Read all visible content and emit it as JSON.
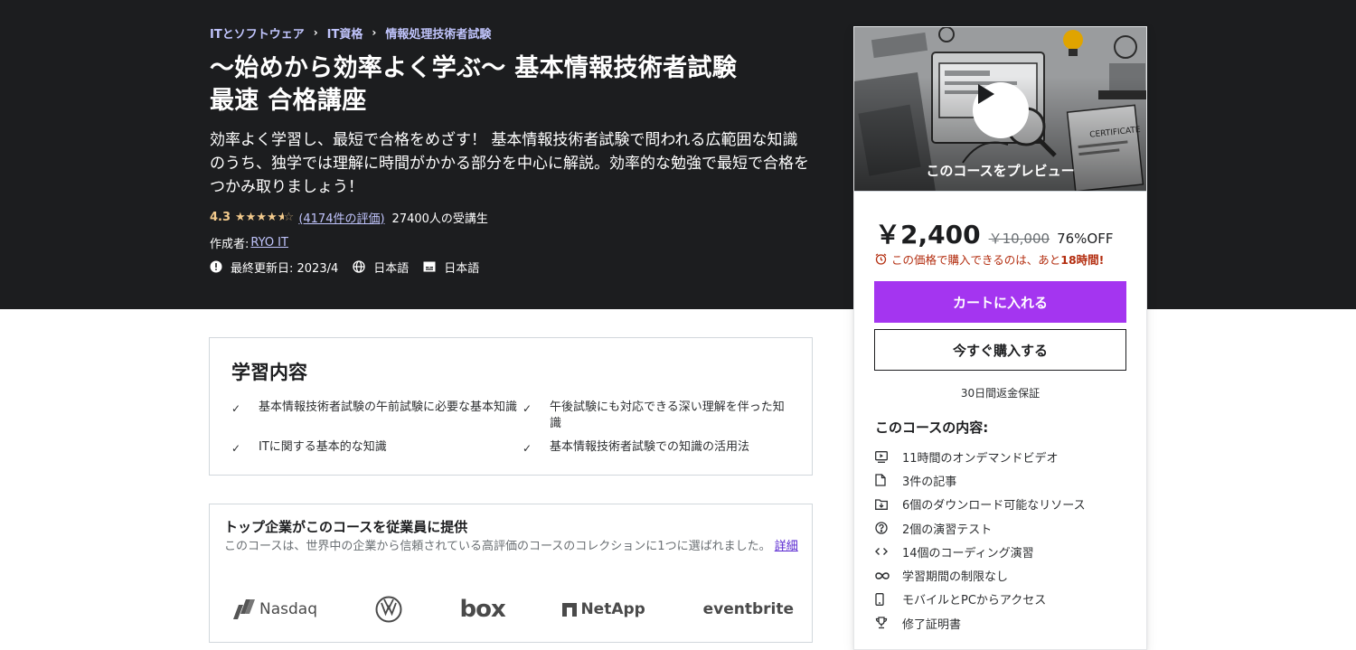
{
  "breadcrumb": [
    "ITとソフトウェア",
    "IT資格",
    "情報処理技術者試験"
  ],
  "course": {
    "title_line1": "〜始めから効率よく学ぶ〜 基本情報技術者試験",
    "title_line2": "最速 合格講座",
    "subtitle": "効率よく学習し、最短で合格をめざす！ 基本情報技術者試験で問われる広範囲な知識のうち、独学では理解に時間がかかる部分を中心に解説。効率的な勉強で最短で合格をつかみ取りましょう！",
    "rating": "4.3",
    "rating_value": 4.3,
    "rating_count": "(4174件の評価)",
    "students": "27400人の受講生",
    "author_label": "作成者:",
    "author": "RYO IT",
    "updated": "最終更新日: 2023/4",
    "language": "日本語",
    "captions": "日本語"
  },
  "learn": {
    "title": "学習内容",
    "items": [
      "基本情報技術者試験の午前試験に必要な基本知識",
      "午後試験にも対応できる深い理解を伴った知識",
      "ITに関する基本的な知識",
      "基本情報技術者試験での知識の活用法"
    ]
  },
  "business": {
    "title": "トップ企業がこのコースを従業員に提供",
    "description": "このコースは、世界中の企業から信頼されている高評価のコースのコレクションに1つに選ばれました。",
    "more": "詳細",
    "logos": [
      "Nasdaq",
      "Volkswagen",
      "box",
      "NetApp",
      "eventbrite"
    ]
  },
  "sidebar": {
    "preview_label": "このコースをプレビュー",
    "price": "￥2,400",
    "original_price": "￥10,000",
    "discount": "76%OFF",
    "urgency_prefix": "この価格で購入できるのは、あと",
    "urgency_time": "18時間!",
    "add_to_cart": "カートに入れる",
    "buy_now": "今すぐ購入する",
    "guarantee": "30日間返金保証",
    "includes_title": "このコースの内容:",
    "includes": [
      {
        "icon": "video-icon",
        "label": "11時間のオンデマンドビデオ"
      },
      {
        "icon": "file-icon",
        "label": "3件の記事"
      },
      {
        "icon": "download-folder-icon",
        "label": "6個のダウンロード可能なリソース"
      },
      {
        "icon": "question-icon",
        "label": "2個の演習テスト"
      },
      {
        "icon": "code-icon",
        "label": "14個のコーディング演習"
      },
      {
        "icon": "infinity-icon",
        "label": "学習期間の制限なし"
      },
      {
        "icon": "mobile-icon",
        "label": "モバイルとPCからアクセス"
      },
      {
        "icon": "trophy-icon",
        "label": "修了証明書"
      }
    ]
  },
  "colors": {
    "hero_bg": "#1c1d1f",
    "accent_purple": "#a435f0",
    "link_purple": "#c0c4fc",
    "star": "#f3ca8c",
    "urgency_red": "#b32d0f"
  }
}
